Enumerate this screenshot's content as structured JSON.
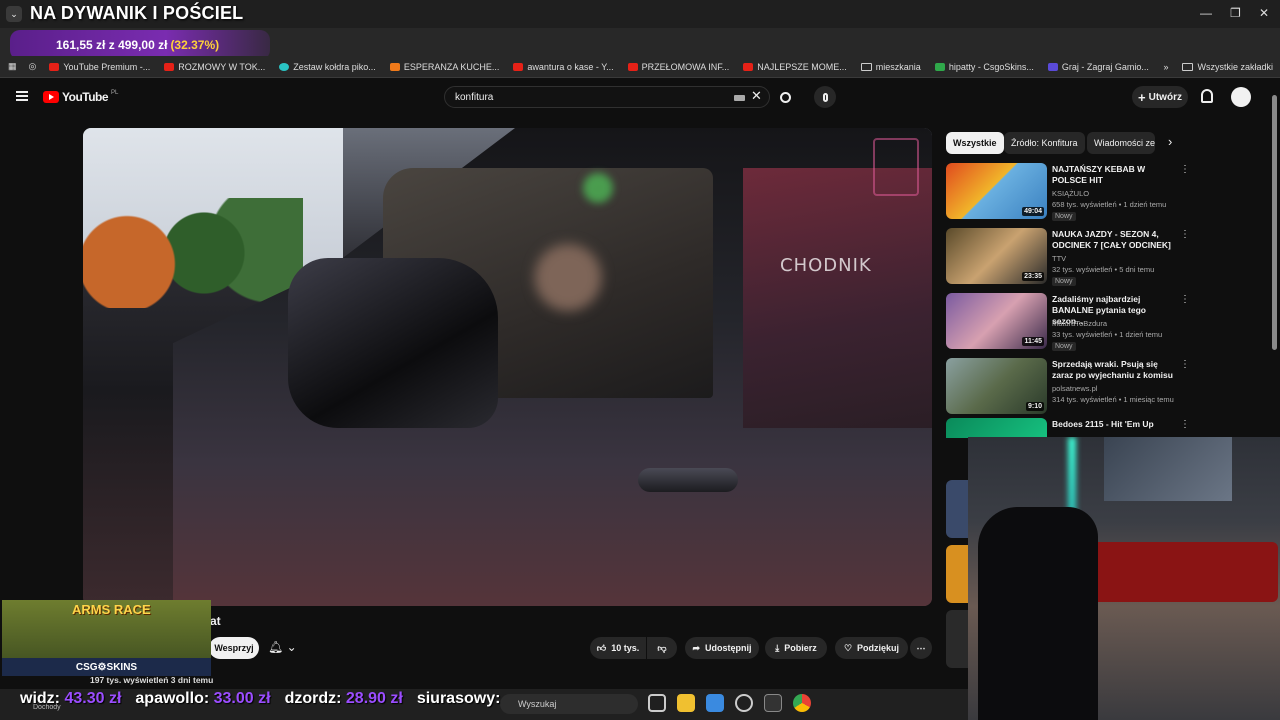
{
  "overlay": {
    "title": "NA DYWANIK I POŚCIEL",
    "donation_amount": "161,55 zł",
    "donation_separator": "z",
    "donation_goal": "499,00 zł",
    "donation_percent": "(32.37%)"
  },
  "window_controls": {
    "minimize": "—",
    "maximize": "❐",
    "close": "✕"
  },
  "bookmarks": [
    "YouTube Premium -...",
    "ROZMOWY W TOK...",
    "Zestaw kołdra piko...",
    "ESPERANZA KUCHE...",
    "awantura o kase - Y...",
    "PRZEŁOMOWA INF...",
    "NAJLEPSZE MOME...",
    "mieszkania",
    "hipatty - CsgoSkins...",
    "Graj - Zagraj Gamio..."
  ],
  "bookmarks_more": "»",
  "all_bookmarks": "Wszystkie zakładki",
  "youtube": {
    "logo": "YouTube",
    "country": "PL",
    "search_value": "konfitura",
    "create_label": "Utwórz"
  },
  "video": {
    "watermark": "CHODNIK",
    "title_fragment": "at",
    "subscribe_label": "Wesprzyj",
    "likes": "10 tys.",
    "share": "Udostępnij",
    "download": "Pobierz",
    "thanks": "Podziękuj",
    "more": "⋯"
  },
  "sidebar": {
    "chips": [
      "Wszystkie",
      "Źródło: Konfitura",
      "Wiadomości ze"
    ],
    "recommendations": [
      {
        "title": "NAJTAŃSZY KEBAB W POLSCE HIT",
        "channel": "KSIĄŻULO",
        "meta": "658 tys. wyświetleń • 1 dzień temu",
        "duration": "49:04",
        "badge": "Nowy",
        "thumb_color": "#d23a1e"
      },
      {
        "title": "NAUKA JAZDY - SEZON 4, ODCINEK 7 [CAŁY ODCINEK]",
        "channel": "TTV",
        "meta": "32 tys. wyświetleń • 5 dni temu",
        "duration": "23:35",
        "badge": "Nowy",
        "thumb_color": "#3a3020"
      },
      {
        "title": "Zadaliśmy najbardziej BANALNE pytania tego sezon...",
        "channel": "MaturaToBzdura",
        "meta": "33 tys. wyświetleń • 1 dzień temu",
        "duration": "11:45",
        "badge": "Nowy",
        "thumb_color": "#4a3a6a"
      },
      {
        "title": "Sprzedają wraki. Psują się zaraz po wyjechaniu z komisu",
        "channel": "polsatnews.pl",
        "meta": "314 tys. wyświetleń • 1 miesiąc temu",
        "duration": "9:10",
        "badge": "",
        "thumb_color": "#5b6a55"
      },
      {
        "title": "Bedoes 2115 - Hit 'Em Up",
        "channel": "",
        "meta": "",
        "duration": "",
        "badge": "",
        "thumb_color": "#0f6a4a"
      }
    ]
  },
  "promo": {
    "headline": "ARMS RACE",
    "brand": "CSG⚙SKINS"
  },
  "views_fragment": "197 tys. wyświetleń  3 dni temu",
  "ticker": [
    {
      "name": "widz:",
      "amount": "43.30 zł"
    },
    {
      "name": "apawollo:",
      "amount": "33.00 zł"
    },
    {
      "name": "dzordz:",
      "amount": "28.90 zł"
    },
    {
      "name": "siurasowy:",
      "amount": ""
    }
  ],
  "taskbar": {
    "search_placeholder": "Wyszukaj",
    "dochody": "Dochody"
  },
  "colors": {
    "yt_red": "#ff0000",
    "overlay_purple": "#7a2cb0",
    "ticker_amount": "#9b4dff"
  }
}
